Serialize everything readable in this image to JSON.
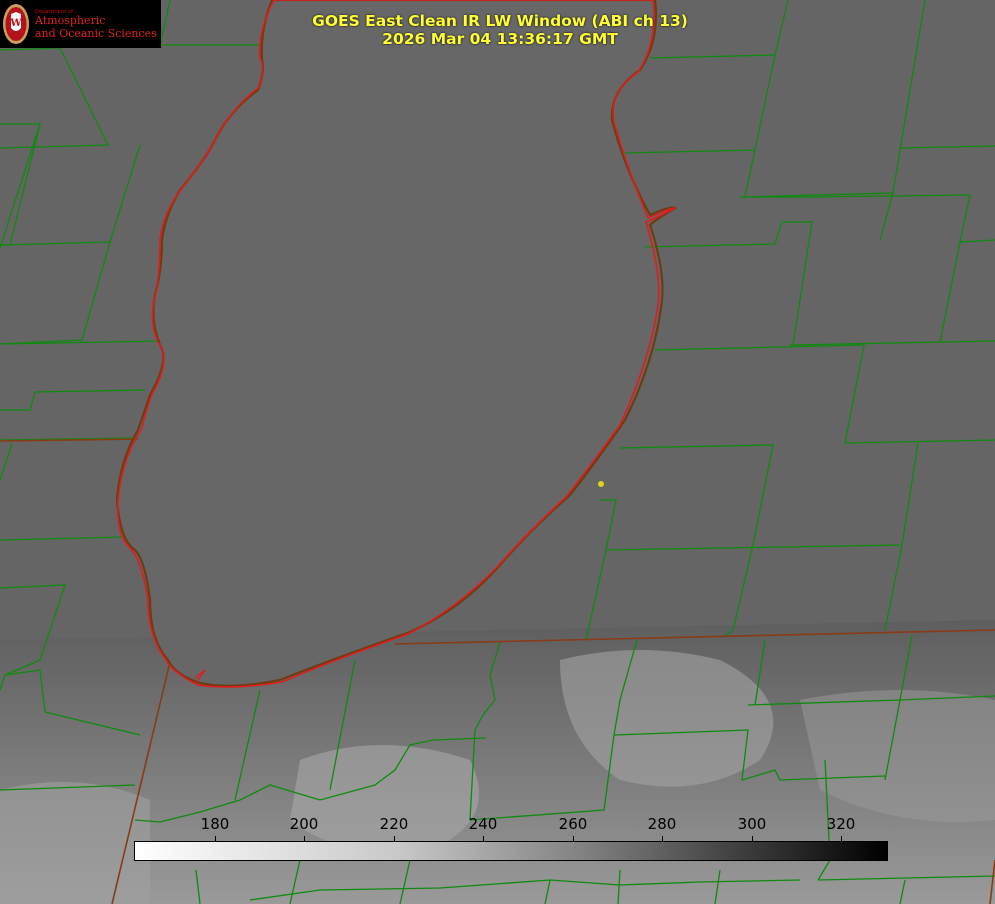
{
  "header": {
    "title_line1": "GOES East Clean IR LW Window (ABI ch 13)",
    "title_line2": "2026 Mar 04 13:36:17 GMT"
  },
  "logo": {
    "department": "Department of",
    "name_line1": "Atmospheric",
    "name_line2": "and Oceanic Sciences",
    "seal_letter": "W"
  },
  "colorbar": {
    "ticks": [
      "180",
      "200",
      "220",
      "240",
      "260",
      "280",
      "300",
      "320"
    ],
    "gradient": "white-to-black"
  },
  "colors": {
    "coastline": "#e21b1b",
    "county_borders": "#0f8a0f",
    "title_text": "#ffff33"
  }
}
